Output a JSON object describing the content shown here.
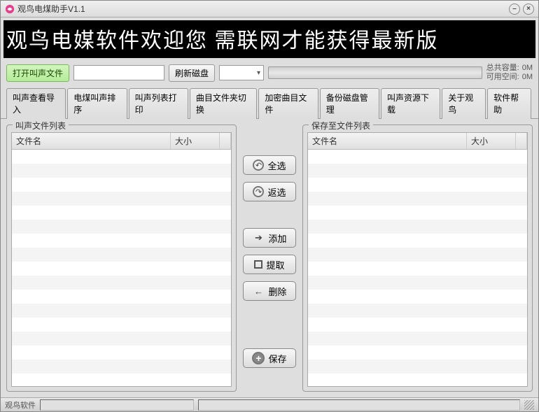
{
  "window": {
    "title": "观鸟电煤助手V1.1"
  },
  "banner": "观鸟电媒软件欢迎您  需联网才能获得最新版",
  "toolbar": {
    "open_file_label": "打开叫声文件",
    "file_input_value": "",
    "refresh_label": "刷新磁盘",
    "disk_total_label": "总共容量:",
    "disk_total_value": "0M",
    "disk_free_label": "可用空间:",
    "disk_free_value": "0M"
  },
  "tabs": [
    {
      "label": "叫声查看导入",
      "active": true
    },
    {
      "label": "电煤叫声排序",
      "active": false
    },
    {
      "label": "叫声列表打印",
      "active": false
    },
    {
      "label": "曲目文件夹切换",
      "active": false
    },
    {
      "label": "加密曲目文件",
      "active": false
    },
    {
      "label": "备份磁盘管理",
      "active": false
    },
    {
      "label": "叫声资源下载",
      "active": false
    },
    {
      "label": "关于观鸟",
      "active": false
    },
    {
      "label": "软件帮助",
      "active": false
    }
  ],
  "panels": {
    "left_title": "叫声文件列表",
    "right_title": "保存至文件列表",
    "col_name": "文件名",
    "col_size": "大小"
  },
  "middle": {
    "select_all": "全选",
    "invert": "返选",
    "add": "添加",
    "extract": "提取",
    "delete": "删除",
    "save": "保存"
  },
  "status": {
    "app": "观鸟软件"
  }
}
